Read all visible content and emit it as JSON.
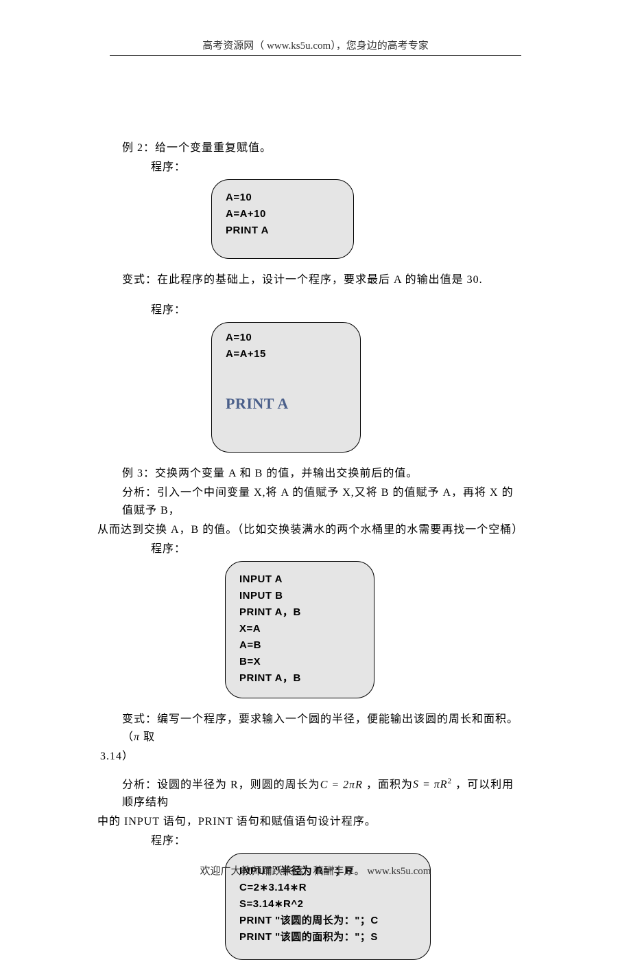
{
  "header": {
    "text": "高考资源网（ www.ks5u.com），您身边的高考专家"
  },
  "footer": {
    "text": "欢迎广大教师踊跃来稿，稿酬丰厚。 www.ks5u.com"
  },
  "ex2": {
    "title": "例 2：给一个变量重复赋值。",
    "label": "程序：",
    "code": [
      "A=10",
      "A=A+10",
      "PRINT  A"
    ]
  },
  "var2": {
    "title": "变式：在此程序的基础上，设计一个程序，要求最后 A 的输出值是 30.",
    "label": "程序：",
    "code_top": [
      "A=10",
      "A=A+15"
    ],
    "code_highlight": "PRINT A",
    "code_clip": ""
  },
  "ex3": {
    "title": "例 3：交换两个变量 A 和 B 的值，并输出交换前后的值。",
    "analysis_l1": "分析：引入一个中间变量 X,将 A 的值赋予 X,又将 B 的值赋予 A，再将 X 的值赋予 B，",
    "analysis_l2": "从而达到交换 A，B 的值。（比如交换装满水的两个水桶里的水需要再找一个空桶）",
    "label": "程序：",
    "code": [
      "INPUT  A",
      "INPUT  B",
      "PRINT  A，B",
      "X=A",
      "A=B",
      "B=X",
      "PRINT  A，B"
    ]
  },
  "var3": {
    "line1_a": "变式：编写一个程序，要求输入一个圆的半径，便能输出该圆的周长和面积。（",
    "line1_pi": "π",
    "line1_b": "  取",
    "line2": "3.14）",
    "an_a": "分析：设圆的半径为 R，则圆的周长为",
    "an_C": "C = 2πR",
    "an_b": " ，面积为",
    "an_S": "S = πR",
    "an_sup": "2",
    "an_c": " ，可以利用顺序结构",
    "an_line2": "中的 INPUT 语句，PRINT 语句和赋值语句设计程序。",
    "label": "程序：",
    "code": [
      "INPUT  \"半径为 R=\"；R",
      "C=2∗3.14∗R",
      "S=3.14∗R^2",
      "PRINT  \"该圆的周长为：\"；C",
      "PRINT  \"该圆的面积为：\"；S"
    ]
  }
}
